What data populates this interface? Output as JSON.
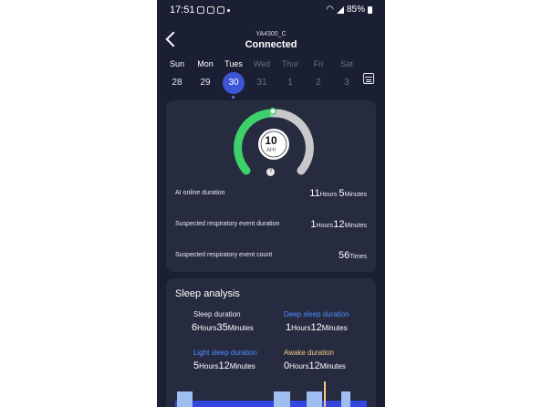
{
  "status_bar": {
    "time": "17:51",
    "battery": "85%"
  },
  "header": {
    "device": "YA4300_C",
    "status": "Connected"
  },
  "week": {
    "days": [
      "Sun",
      "Mon",
      "Tues",
      "Wed",
      "Thur",
      "Fri",
      "Sat"
    ],
    "dates": [
      "28",
      "29",
      "30",
      "31",
      "1",
      "2",
      "3"
    ],
    "selected_index": 2
  },
  "ahi": {
    "value": "10",
    "label": "AHI",
    "help": "?"
  },
  "stats": [
    {
      "label": "AI online duration",
      "n1": "11",
      "u1": "Hours",
      "n2": "5",
      "u2": "Minutes"
    },
    {
      "label": "Suspected respiratory event duration",
      "n1": "1",
      "u1": "Hours",
      "n2": "12",
      "u2": "Minutes"
    },
    {
      "label": "Suspected respiratory event count",
      "n1": "56",
      "u1": "Times"
    }
  ],
  "sleep": {
    "title": "Sleep analysis",
    "sleep_duration": {
      "label": "Sleep duration",
      "h": "6",
      "hu": "Hours",
      "m": "35",
      "mu": "Minutes"
    },
    "deep_sleep": {
      "label": "Deep sleep duration",
      "h": "1",
      "hu": "Hours",
      "m": "12",
      "mu": "Minutes"
    },
    "light_sleep": {
      "label": "Light sleep duration",
      "h": "5",
      "hu": "Hours",
      "m": "12",
      "mu": "Minutes"
    },
    "awake": {
      "label": "Awake duration",
      "h": "0",
      "hu": "Hours",
      "m": "12",
      "mu": "Minutes"
    }
  },
  "colors": {
    "accent": "#3d56d8",
    "gauge_green": "#3ed06a",
    "gauge_grey": "#c9c9cc",
    "deep_sleep": "#3346dd",
    "light_sleep": "#9fbff0",
    "awake": "#f0c98a"
  },
  "icons": [
    "back-icon",
    "calendar-icon",
    "help-icon",
    "wifi-icon",
    "signal-icon",
    "battery-icon"
  ]
}
